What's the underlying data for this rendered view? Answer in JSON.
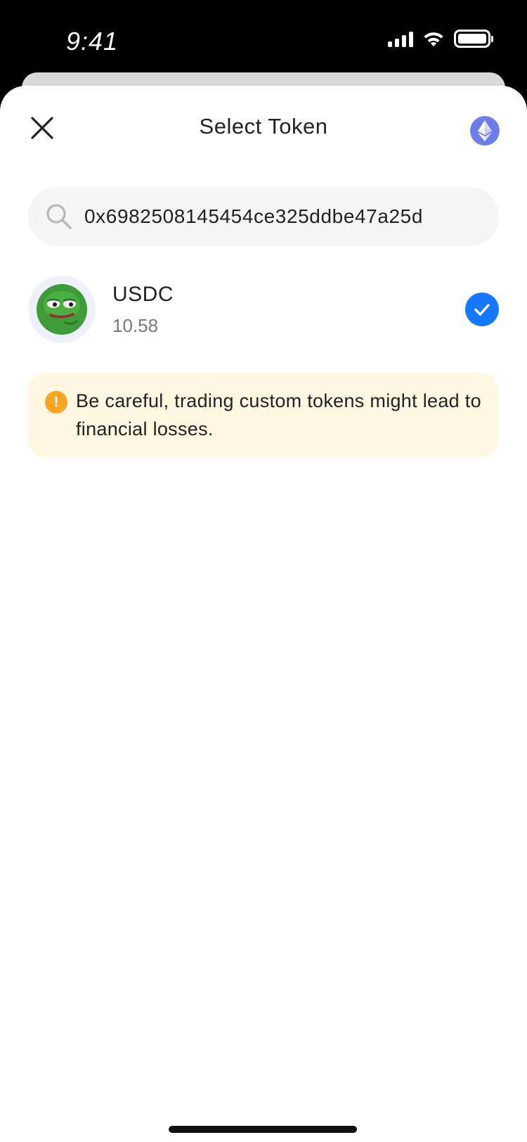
{
  "status_bar": {
    "time": "9:41"
  },
  "header": {
    "title": "Select Token",
    "close_icon": "close-icon",
    "network_icon": "ethereum-icon"
  },
  "search": {
    "value": "0x6982508145454ce325ddbe47a25d",
    "icon": "search-icon"
  },
  "tokens": [
    {
      "symbol": "USDC",
      "balance": "10.58",
      "selected": true,
      "avatar_icon": "pepe-frog-icon"
    }
  ],
  "warning": {
    "text": "Be careful, trading custom tokens might lead to financial losses.",
    "icon": "exclamation-icon"
  },
  "colors": {
    "accent": "#1677ff",
    "warning_bg": "#fff7e1",
    "warning_icon": "#f5a623",
    "network_bg": "#6f7de6",
    "search_bg": "#f5f5f6"
  }
}
